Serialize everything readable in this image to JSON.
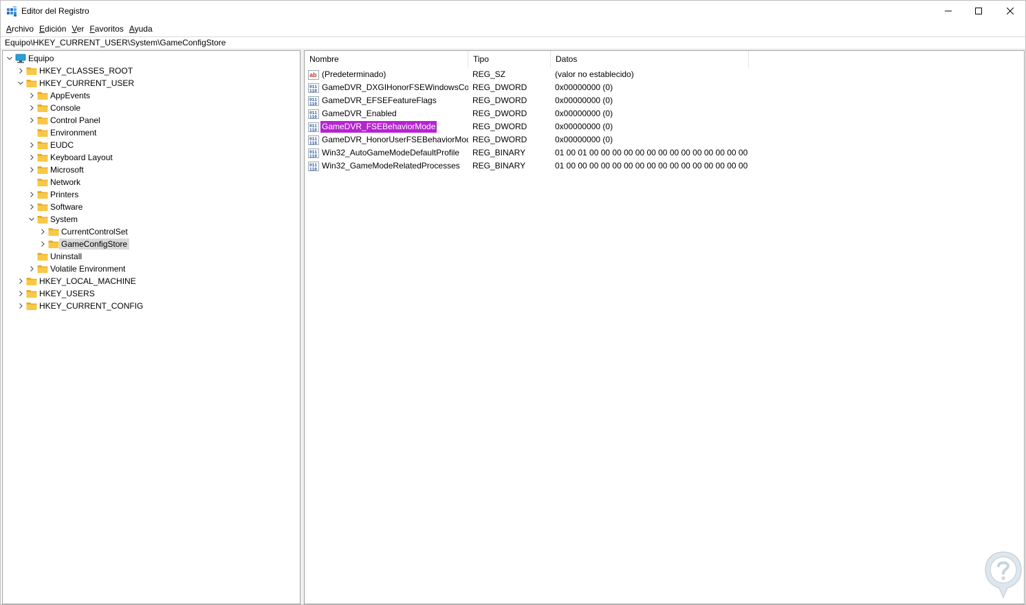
{
  "window": {
    "title": "Editor del Registro",
    "controls": {
      "minimize": "minimize-icon",
      "maximize": "maximize-icon",
      "close": "close-icon"
    }
  },
  "menu": [
    {
      "accel": "A",
      "rest": "rchivo"
    },
    {
      "accel": "E",
      "rest": "dición"
    },
    {
      "accel": "V",
      "rest": "er"
    },
    {
      "accel": "F",
      "rest": "avoritos"
    },
    {
      "accel": "A",
      "rest": "yuda"
    }
  ],
  "address": "Equipo\\HKEY_CURRENT_USER\\System\\GameConfigStore",
  "tree": [
    {
      "label": "Equipo",
      "level": 0,
      "expander": "expanded",
      "icon": "computer-icon"
    },
    {
      "label": "HKEY_CLASSES_ROOT",
      "level": 1,
      "expander": "collapsed",
      "icon": "folder-icon"
    },
    {
      "label": "HKEY_CURRENT_USER",
      "level": 1,
      "expander": "expanded",
      "icon": "folder-icon"
    },
    {
      "label": "AppEvents",
      "level": 2,
      "expander": "collapsed",
      "icon": "folder-icon"
    },
    {
      "label": "Console",
      "level": 2,
      "expander": "collapsed",
      "icon": "folder-icon"
    },
    {
      "label": "Control Panel",
      "level": 2,
      "expander": "collapsed",
      "icon": "folder-icon"
    },
    {
      "label": "Environment",
      "level": 2,
      "expander": "none",
      "icon": "folder-icon"
    },
    {
      "label": "EUDC",
      "level": 2,
      "expander": "collapsed",
      "icon": "folder-icon"
    },
    {
      "label": "Keyboard Layout",
      "level": 2,
      "expander": "collapsed",
      "icon": "folder-icon"
    },
    {
      "label": "Microsoft",
      "level": 2,
      "expander": "collapsed",
      "icon": "folder-icon"
    },
    {
      "label": "Network",
      "level": 2,
      "expander": "none",
      "icon": "folder-icon"
    },
    {
      "label": "Printers",
      "level": 2,
      "expander": "collapsed",
      "icon": "folder-icon"
    },
    {
      "label": "Software",
      "level": 2,
      "expander": "collapsed",
      "icon": "folder-icon"
    },
    {
      "label": "System",
      "level": 2,
      "expander": "expanded",
      "icon": "folder-icon"
    },
    {
      "label": "CurrentControlSet",
      "level": 3,
      "expander": "collapsed",
      "icon": "folder-icon"
    },
    {
      "label": "GameConfigStore",
      "level": 3,
      "expander": "collapsed",
      "icon": "folder-icon",
      "selected": true
    },
    {
      "label": "Uninstall",
      "level": 2,
      "expander": "none",
      "icon": "folder-icon"
    },
    {
      "label": "Volatile Environment",
      "level": 2,
      "expander": "collapsed",
      "icon": "folder-icon"
    },
    {
      "label": "HKEY_LOCAL_MACHINE",
      "level": 1,
      "expander": "collapsed",
      "icon": "folder-icon"
    },
    {
      "label": "HKEY_USERS",
      "level": 1,
      "expander": "collapsed",
      "icon": "folder-icon"
    },
    {
      "label": "HKEY_CURRENT_CONFIG",
      "level": 1,
      "expander": "collapsed",
      "icon": "folder-icon"
    }
  ],
  "columns": {
    "name": "Nombre",
    "type": "Tipo",
    "data": "Datos"
  },
  "values": [
    {
      "name": "(Predeterminado)",
      "type": "REG_SZ",
      "data": "(valor no establecido)",
      "icon": "string-value-icon"
    },
    {
      "name": "GameDVR_DXGIHonorFSEWindowsCo...",
      "type": "REG_DWORD",
      "data": "0x00000000 (0)",
      "icon": "binary-value-icon"
    },
    {
      "name": "GameDVR_EFSEFeatureFlags",
      "type": "REG_DWORD",
      "data": "0x00000000 (0)",
      "icon": "binary-value-icon"
    },
    {
      "name": "GameDVR_Enabled",
      "type": "REG_DWORD",
      "data": "0x00000000 (0)",
      "icon": "binary-value-icon"
    },
    {
      "name": "GameDVR_FSEBehaviorMode",
      "type": "REG_DWORD",
      "data": "0x00000000 (0)",
      "icon": "binary-value-icon",
      "highlighted": true
    },
    {
      "name": "GameDVR_HonorUserFSEBehaviorMode",
      "type": "REG_DWORD",
      "data": "0x00000000 (0)",
      "icon": "binary-value-icon"
    },
    {
      "name": "Win32_AutoGameModeDefaultProfile",
      "type": "REG_BINARY",
      "data": "01 00 01 00 00 00 00 00 00 00 00 00 00 00 00 00 00 00 00...",
      "icon": "binary-value-icon"
    },
    {
      "name": "Win32_GameModeRelatedProcesses",
      "type": "REG_BINARY",
      "data": "01 00 00 00 00 00 00 00 00 00 00 00 00 00 00 00 00 00 00...",
      "icon": "binary-value-icon"
    }
  ],
  "colors": {
    "highlight": "#b624cf",
    "selection": "#d9d9d9",
    "folder": "#f8c846",
    "accent": "#0078d4"
  },
  "watermark": "watermark-logo"
}
